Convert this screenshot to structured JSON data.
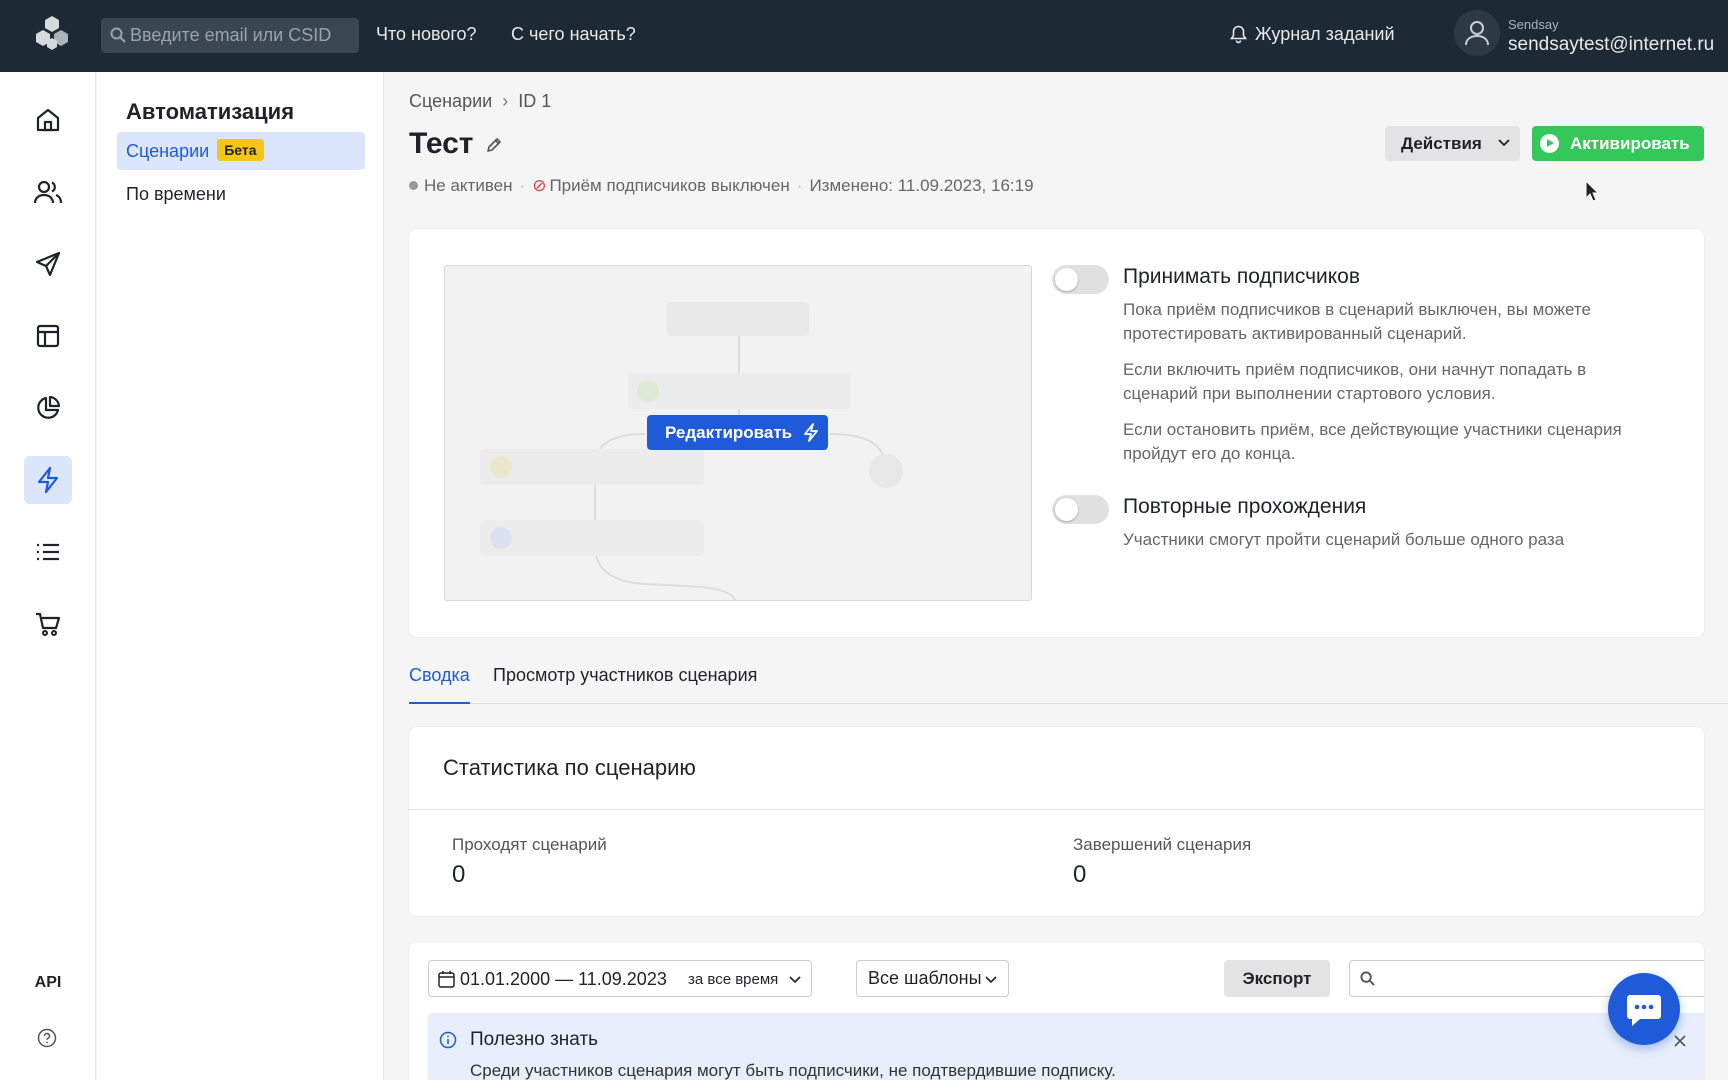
{
  "topbar": {
    "search_placeholder": "Введите email или CSID",
    "links": [
      "Что нового?",
      "С чего начать?"
    ],
    "journal": "Журнал заданий",
    "user_org": "Sendsay",
    "user_email": "sendsaytest@internet.ru"
  },
  "rail": {
    "items": [
      "home-icon",
      "users-icon",
      "send-icon",
      "layout-icon",
      "pie-chart-icon",
      "lightning-icon",
      "list-icon",
      "cart-icon"
    ],
    "active": "lightning-icon",
    "api_label": "API"
  },
  "submenu": {
    "title": "Автоматизация",
    "items": [
      {
        "label": "Сценарии",
        "badge": "Бета"
      },
      {
        "label": "По времени"
      }
    ]
  },
  "page": {
    "breadcrumb": [
      "Сценарии",
      "ID 1"
    ],
    "title": "Тест",
    "status": "Не активен",
    "subscription_status": "Приём подписчиков выключен",
    "modified": "Изменено: 11.09.2023, 16:19",
    "actions_label": "Действия",
    "activate_label": "Активировать"
  },
  "preview": {
    "edit_label": "Редактировать"
  },
  "settings": {
    "accept": {
      "title": "Принимать подписчиков",
      "paragraphs": [
        "Пока приём подписчиков в сценарий выключен, вы можете протестировать активированный сценарий.",
        "Если включить приём подписчиков, они начнут попадать в сценарий при выполнении стартового условия.",
        "Если остановить приём, все действующие участники сценария пройдут его до конца."
      ]
    },
    "repeat": {
      "title": "Повторные прохождения",
      "description": "Участники смогут пройти сценарий больше одного раза"
    }
  },
  "tabs": [
    "Сводка",
    "Просмотр участников сценария"
  ],
  "stats": {
    "title": "Статистика по сценарию",
    "items": [
      {
        "label": "Проходят сценарий",
        "value": "0"
      },
      {
        "label": "Завершений сценария",
        "value": "0"
      }
    ]
  },
  "filters": {
    "date_range": "01.01.2000 — 11.09.2023",
    "period": "за все время",
    "templates": "Все шаблоны",
    "export_label": "Экспорт",
    "search_value": ""
  },
  "info": {
    "title": "Полезно знать",
    "text": "Среди участников сценария могут быть подписчики, не подтвердившие подписку."
  },
  "colors": {
    "topbar": "#1e2a33",
    "accent": "#1f5bd8",
    "activate": "#34c759",
    "beta_badge": "#f5c518"
  }
}
